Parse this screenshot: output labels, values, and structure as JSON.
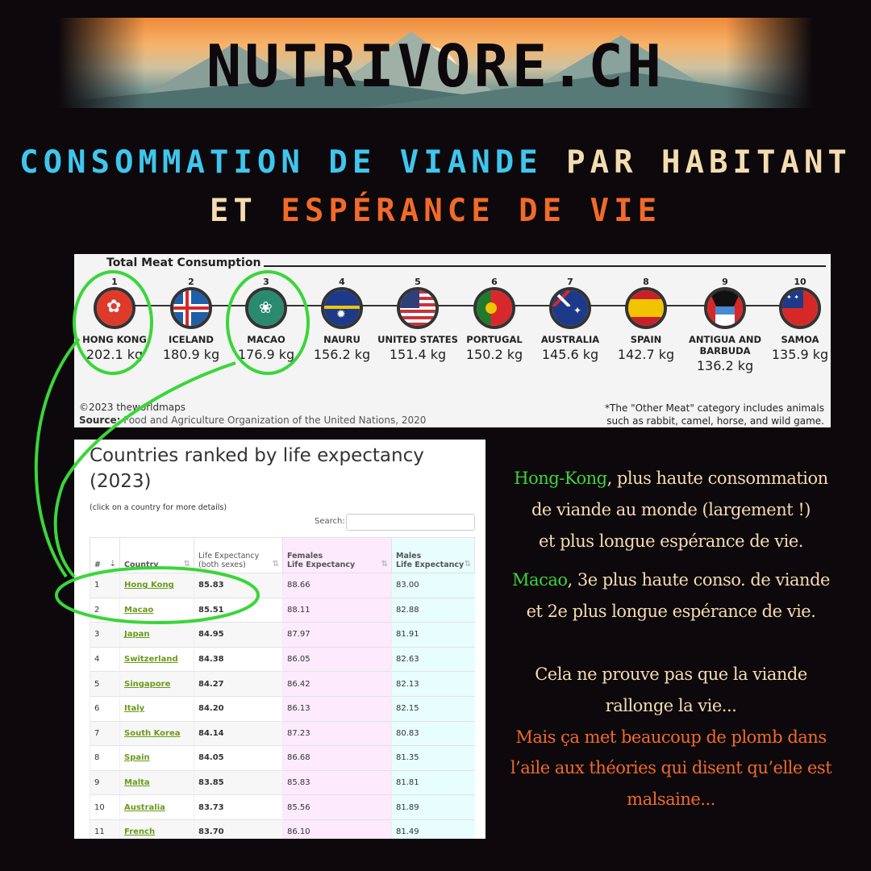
{
  "banner": {
    "logo": "NUTRIVORE.CH"
  },
  "title": {
    "l1a": "CONSOMMATION DE VIANDE",
    "l1b": "PAR HABITANT",
    "l2a": "ET",
    "l2b": "ESPÉRANCE DE VIE"
  },
  "colors": {
    "cyan": "#3ec6ee",
    "cream": "#f5dcb0",
    "orange": "#f26a2a",
    "green": "#3ad63a"
  },
  "meat": {
    "title": "Total Meat Consumption",
    "items": [
      {
        "rank": "1",
        "name": "HONG KONG",
        "value": "202.1 kg",
        "flag": "hong-kong-flag"
      },
      {
        "rank": "2",
        "name": "ICELAND",
        "value": "180.9 kg",
        "flag": "iceland-flag"
      },
      {
        "rank": "3",
        "name": "MACAO",
        "value": "176.9 kg",
        "flag": "macao-flag"
      },
      {
        "rank": "4",
        "name": "NAURU",
        "value": "156.2 kg",
        "flag": "nauru-flag"
      },
      {
        "rank": "5",
        "name": "UNITED STATES",
        "value": "151.4 kg",
        "flag": "usa-flag"
      },
      {
        "rank": "6",
        "name": "PORTUGAL",
        "value": "150.2 kg",
        "flag": "portugal-flag"
      },
      {
        "rank": "7",
        "name": "AUSTRALIA",
        "value": "145.6 kg",
        "flag": "australia-flag"
      },
      {
        "rank": "8",
        "name": "SPAIN",
        "value": "142.7 kg",
        "flag": "spain-flag"
      },
      {
        "rank": "9",
        "name": "ANTIGUA AND BARBUDA",
        "value": "136.2 kg",
        "flag": "antigua-flag"
      },
      {
        "rank": "10",
        "name": "SAMOA",
        "value": "135.9 kg",
        "flag": "samoa-flag"
      }
    ],
    "copyright": "©2023 theworldmaps",
    "source_label": "Source:",
    "source": "Food and Agriculture Organization of the United Nations, 2020",
    "note1": "*The \"Other Meat\" category includes animals",
    "note2": "such as rabbit, camel, horse, and wild game."
  },
  "life": {
    "title": "Countries ranked by life expectancy (2023)",
    "hint": "(click on a country for more details)",
    "search_label": "Search:",
    "search_value": "",
    "headers": {
      "rank": "#",
      "country": "Country",
      "both1": "Life Expectancy",
      "both2": "(both sexes)",
      "f1": "Females",
      "f2": "Life Expectancy",
      "m1": "Males",
      "m2": "Life Expectancy"
    },
    "rows": [
      [
        "1",
        "Hong Kong",
        "85.83",
        "88.66",
        "83.00"
      ],
      [
        "2",
        "Macao",
        "85.51",
        "88.11",
        "82.88"
      ],
      [
        "3",
        "Japan",
        "84.95",
        "87.97",
        "81.91"
      ],
      [
        "4",
        "Switzerland",
        "84.38",
        "86.05",
        "82.63"
      ],
      [
        "5",
        "Singapore",
        "84.27",
        "86.42",
        "82.13"
      ],
      [
        "6",
        "Italy",
        "84.20",
        "86.13",
        "82.15"
      ],
      [
        "7",
        "South Korea",
        "84.14",
        "87.23",
        "80.83"
      ],
      [
        "8",
        "Spain",
        "84.05",
        "86.68",
        "81.35"
      ],
      [
        "9",
        "Malta",
        "83.85",
        "85.83",
        "81.81"
      ],
      [
        "10",
        "Australia",
        "83.73",
        "85.56",
        "81.89"
      ],
      [
        "11",
        "French",
        "83.70",
        "86.10",
        "81.49"
      ]
    ]
  },
  "commentary": {
    "p1_hl": "Hong-Kong",
    "p1_a": ", plus haute consommation",
    "p1_b": "de viande au monde (largement !)",
    "p1_c": "et plus longue espérance de vie.",
    "p2_hl": "Macao",
    "p2_a": ", 3e plus haute conso. de viande",
    "p2_b": "et 2e plus longue espérance de vie.",
    "p3_a": "Cela ne prouve pas que la viande",
    "p3_b": "rallonge la vie...",
    "p4_a": "Mais ça met beaucoup de plomb dans",
    "p4_b": "l’aile aux théories qui disent qu’elle est",
    "p4_c": "malsaine..."
  }
}
